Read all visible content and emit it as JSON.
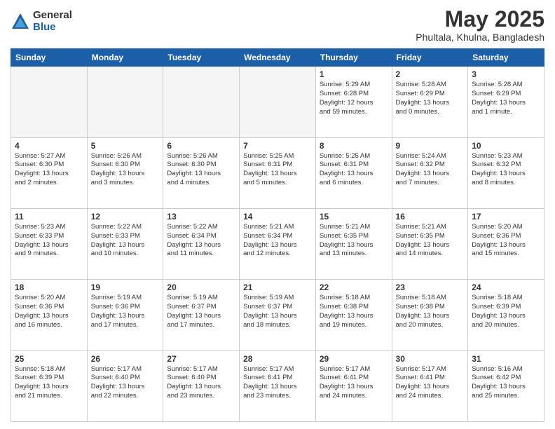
{
  "logo": {
    "general": "General",
    "blue": "Blue"
  },
  "title": "May 2025",
  "location": "Phultala, Khulna, Bangladesh",
  "days_of_week": [
    "Sunday",
    "Monday",
    "Tuesday",
    "Wednesday",
    "Thursday",
    "Friday",
    "Saturday"
  ],
  "weeks": [
    [
      {
        "day": "",
        "info": ""
      },
      {
        "day": "",
        "info": ""
      },
      {
        "day": "",
        "info": ""
      },
      {
        "day": "",
        "info": ""
      },
      {
        "day": "1",
        "info": "Sunrise: 5:29 AM\nSunset: 6:28 PM\nDaylight: 12 hours\nand 59 minutes."
      },
      {
        "day": "2",
        "info": "Sunrise: 5:28 AM\nSunset: 6:29 PM\nDaylight: 13 hours\nand 0 minutes."
      },
      {
        "day": "3",
        "info": "Sunrise: 5:28 AM\nSunset: 6:29 PM\nDaylight: 13 hours\nand 1 minute."
      }
    ],
    [
      {
        "day": "4",
        "info": "Sunrise: 5:27 AM\nSunset: 6:30 PM\nDaylight: 13 hours\nand 2 minutes."
      },
      {
        "day": "5",
        "info": "Sunrise: 5:26 AM\nSunset: 6:30 PM\nDaylight: 13 hours\nand 3 minutes."
      },
      {
        "day": "6",
        "info": "Sunrise: 5:26 AM\nSunset: 6:30 PM\nDaylight: 13 hours\nand 4 minutes."
      },
      {
        "day": "7",
        "info": "Sunrise: 5:25 AM\nSunset: 6:31 PM\nDaylight: 13 hours\nand 5 minutes."
      },
      {
        "day": "8",
        "info": "Sunrise: 5:25 AM\nSunset: 6:31 PM\nDaylight: 13 hours\nand 6 minutes."
      },
      {
        "day": "9",
        "info": "Sunrise: 5:24 AM\nSunset: 6:32 PM\nDaylight: 13 hours\nand 7 minutes."
      },
      {
        "day": "10",
        "info": "Sunrise: 5:23 AM\nSunset: 6:32 PM\nDaylight: 13 hours\nand 8 minutes."
      }
    ],
    [
      {
        "day": "11",
        "info": "Sunrise: 5:23 AM\nSunset: 6:33 PM\nDaylight: 13 hours\nand 9 minutes."
      },
      {
        "day": "12",
        "info": "Sunrise: 5:22 AM\nSunset: 6:33 PM\nDaylight: 13 hours\nand 10 minutes."
      },
      {
        "day": "13",
        "info": "Sunrise: 5:22 AM\nSunset: 6:34 PM\nDaylight: 13 hours\nand 11 minutes."
      },
      {
        "day": "14",
        "info": "Sunrise: 5:21 AM\nSunset: 6:34 PM\nDaylight: 13 hours\nand 12 minutes."
      },
      {
        "day": "15",
        "info": "Sunrise: 5:21 AM\nSunset: 6:35 PM\nDaylight: 13 hours\nand 13 minutes."
      },
      {
        "day": "16",
        "info": "Sunrise: 5:21 AM\nSunset: 6:35 PM\nDaylight: 13 hours\nand 14 minutes."
      },
      {
        "day": "17",
        "info": "Sunrise: 5:20 AM\nSunset: 6:36 PM\nDaylight: 13 hours\nand 15 minutes."
      }
    ],
    [
      {
        "day": "18",
        "info": "Sunrise: 5:20 AM\nSunset: 6:36 PM\nDaylight: 13 hours\nand 16 minutes."
      },
      {
        "day": "19",
        "info": "Sunrise: 5:19 AM\nSunset: 6:36 PM\nDaylight: 13 hours\nand 17 minutes."
      },
      {
        "day": "20",
        "info": "Sunrise: 5:19 AM\nSunset: 6:37 PM\nDaylight: 13 hours\nand 17 minutes."
      },
      {
        "day": "21",
        "info": "Sunrise: 5:19 AM\nSunset: 6:37 PM\nDaylight: 13 hours\nand 18 minutes."
      },
      {
        "day": "22",
        "info": "Sunrise: 5:18 AM\nSunset: 6:38 PM\nDaylight: 13 hours\nand 19 minutes."
      },
      {
        "day": "23",
        "info": "Sunrise: 5:18 AM\nSunset: 6:38 PM\nDaylight: 13 hours\nand 20 minutes."
      },
      {
        "day": "24",
        "info": "Sunrise: 5:18 AM\nSunset: 6:39 PM\nDaylight: 13 hours\nand 20 minutes."
      }
    ],
    [
      {
        "day": "25",
        "info": "Sunrise: 5:18 AM\nSunset: 6:39 PM\nDaylight: 13 hours\nand 21 minutes."
      },
      {
        "day": "26",
        "info": "Sunrise: 5:17 AM\nSunset: 6:40 PM\nDaylight: 13 hours\nand 22 minutes."
      },
      {
        "day": "27",
        "info": "Sunrise: 5:17 AM\nSunset: 6:40 PM\nDaylight: 13 hours\nand 23 minutes."
      },
      {
        "day": "28",
        "info": "Sunrise: 5:17 AM\nSunset: 6:41 PM\nDaylight: 13 hours\nand 23 minutes."
      },
      {
        "day": "29",
        "info": "Sunrise: 5:17 AM\nSunset: 6:41 PM\nDaylight: 13 hours\nand 24 minutes."
      },
      {
        "day": "30",
        "info": "Sunrise: 5:17 AM\nSunset: 6:41 PM\nDaylight: 13 hours\nand 24 minutes."
      },
      {
        "day": "31",
        "info": "Sunrise: 5:16 AM\nSunset: 6:42 PM\nDaylight: 13 hours\nand 25 minutes."
      }
    ]
  ]
}
